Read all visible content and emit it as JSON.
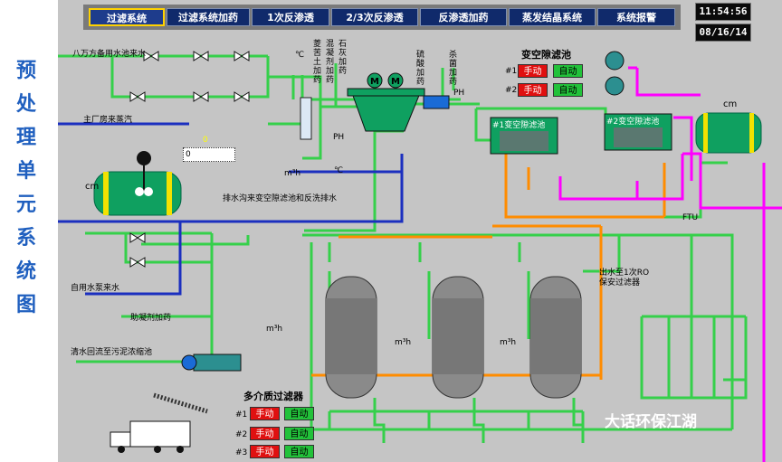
{
  "sidebar": {
    "title_chars": [
      "预",
      "处",
      "理",
      "单",
      "元",
      "系",
      "统",
      "图"
    ]
  },
  "nav": [
    {
      "label": "过滤系统",
      "active": true
    },
    {
      "label": "过滤系统加药",
      "active": false
    },
    {
      "label": "1次反渗透",
      "active": false
    },
    {
      "label": "2/3次反渗透",
      "active": false
    },
    {
      "label": "反渗透加药",
      "active": false
    },
    {
      "label": "蒸发结晶系统",
      "active": false
    },
    {
      "label": "系统报警",
      "active": false
    }
  ],
  "clock": {
    "time": "11:54:56",
    "date": "08/16/14"
  },
  "labels": {
    "water_source": "八万方备用水池来水",
    "steam": "主厂房来蒸汽",
    "drain_return": "排水沟来变空隙滤池和反洗排水",
    "service_water": "自用水泵来水",
    "coagulant": "助凝剂加药",
    "sludge_return": "清水回流至污泥浓缩池",
    "outlet_to_ro": "出水至1次RO",
    "outlet_to_ro_2": "保安过滤器",
    "cm_top_left": "cm",
    "cm_top_right": "cm",
    "deg1": "℃",
    "deg2": "℃",
    "ph1": "PH",
    "ph2": "PH",
    "flow1": "m³h",
    "flow2": "m³h",
    "flow3": "m³h",
    "flow4": "m³h",
    "ftu": "FTU",
    "steam_value": "0",
    "input_value": "0",
    "dose_1": "菱苦土加药",
    "dose_2": "混凝剂加药",
    "dose_3": "石灰加药",
    "dose_4": "硫酸加药",
    "dose_5": "杀菌加药",
    "filter_1": "#1变空隙滤池",
    "filter_2": "#2变空隙滤池"
  },
  "variable_filter": {
    "title": "变空隙滤池",
    "rows": [
      {
        "id": "#1",
        "manual": "手动",
        "auto": "自动"
      },
      {
        "id": "#2",
        "manual": "手动",
        "auto": "自动"
      }
    ]
  },
  "media_filter": {
    "title": "多介质过滤器",
    "rows": [
      {
        "id": "#1",
        "manual": "手动",
        "auto": "自动"
      },
      {
        "id": "#2",
        "manual": "手动",
        "auto": "自动"
      },
      {
        "id": "#3",
        "manual": "手动",
        "auto": "自动"
      }
    ]
  },
  "watermark": "大话环保江湖",
  "colors": {
    "pipe_green": "#35d04a",
    "pipe_orange": "#ff8c00",
    "pipe_magenta": "#ff00ff",
    "pipe_blue": "#1b2fbf",
    "tank_green": "#0fa060",
    "tank_yellow": "#f2e200"
  }
}
